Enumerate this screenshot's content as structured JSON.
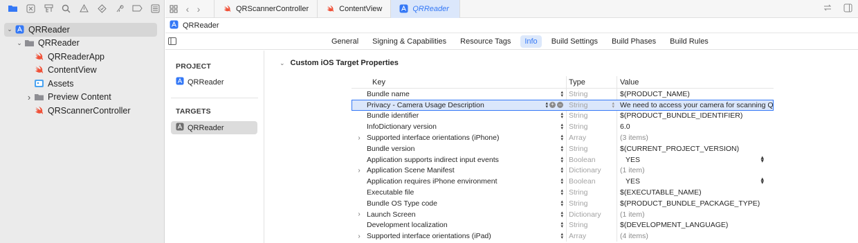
{
  "navigator": {
    "toolbar_icons": [
      "folder-icon",
      "source-control-icon",
      "symbol-hierarchy-icon",
      "find-icon",
      "issue-warning-icon",
      "test-diamond-icon",
      "debug-icon",
      "breakpoint-icon",
      "report-icon"
    ],
    "tree": [
      {
        "label": "QRReader",
        "type": "project",
        "indent": 0,
        "chevron": "down",
        "selected": true
      },
      {
        "label": "QRReader",
        "type": "folder",
        "indent": 1,
        "chevron": "down"
      },
      {
        "label": "QRReaderApp",
        "type": "swift",
        "indent": 2
      },
      {
        "label": "ContentView",
        "type": "swift",
        "indent": 2
      },
      {
        "label": "Assets",
        "type": "assets",
        "indent": 2
      },
      {
        "label": "Preview Content",
        "type": "folder",
        "indent": 2,
        "chevron": "right"
      },
      {
        "label": "QRScannerController",
        "type": "swift",
        "indent": 2
      }
    ]
  },
  "tabs": [
    {
      "label": "QRScannerController",
      "icon": "swift",
      "active": false
    },
    {
      "label": "ContentView",
      "icon": "swift",
      "active": false
    },
    {
      "label": "QRReader",
      "icon": "project",
      "active": true
    }
  ],
  "jumpbar": {
    "label": "QRReader"
  },
  "segments": [
    "General",
    "Signing & Capabilities",
    "Resource Tags",
    "Info",
    "Build Settings",
    "Build Phases",
    "Build Rules"
  ],
  "active_segment": "Info",
  "targets_pane": {
    "project_header": "PROJECT",
    "project_item": "QRReader",
    "targets_header": "TARGETS",
    "target_item": "QRReader"
  },
  "section": {
    "title": "Custom iOS Target Properties"
  },
  "table": {
    "headers": {
      "key": "Key",
      "type": "Type",
      "value": "Value"
    },
    "rows": [
      {
        "key": "Bundle name",
        "type": "String",
        "value": "$(PRODUCT_NAME)"
      },
      {
        "key": "Privacy - Camera Usage Description",
        "type": "String",
        "value": "We need to access your camera for scanning QR",
        "selected": true
      },
      {
        "key": "Bundle identifier",
        "type": "String",
        "value": "$(PRODUCT_BUNDLE_IDENTIFIER)"
      },
      {
        "key": "InfoDictionary version",
        "type": "String",
        "value": "6.0"
      },
      {
        "key": "Supported interface orientations (iPhone)",
        "type": "Array",
        "value": "(3 items)",
        "expandable": true,
        "muted": true
      },
      {
        "key": "Bundle version",
        "type": "String",
        "value": "$(CURRENT_PROJECT_VERSION)"
      },
      {
        "key": "Application supports indirect input events",
        "type": "Boolean",
        "value": "YES",
        "bool": true
      },
      {
        "key": "Application Scene Manifest",
        "type": "Dictionary",
        "value": "(1 item)",
        "expandable": true,
        "muted": true
      },
      {
        "key": "Application requires iPhone environment",
        "type": "Boolean",
        "value": "YES",
        "bool": true
      },
      {
        "key": "Executable file",
        "type": "String",
        "value": "$(EXECUTABLE_NAME)"
      },
      {
        "key": "Bundle OS Type code",
        "type": "String",
        "value": "$(PRODUCT_BUNDLE_PACKAGE_TYPE)"
      },
      {
        "key": "Launch Screen",
        "type": "Dictionary",
        "value": "(1 item)",
        "expandable": true,
        "muted": true
      },
      {
        "key": "Development localization",
        "type": "String",
        "value": "$(DEVELOPMENT_LANGUAGE)"
      },
      {
        "key": "Supported interface orientations (iPad)",
        "type": "Array",
        "value": "(4 items)",
        "expandable": true,
        "muted": true
      }
    ]
  },
  "colors": {
    "accent": "#3478f6",
    "swift": "#f05138",
    "sidebar_bg": "#ebebeb",
    "selection": "#dbe7fb"
  }
}
